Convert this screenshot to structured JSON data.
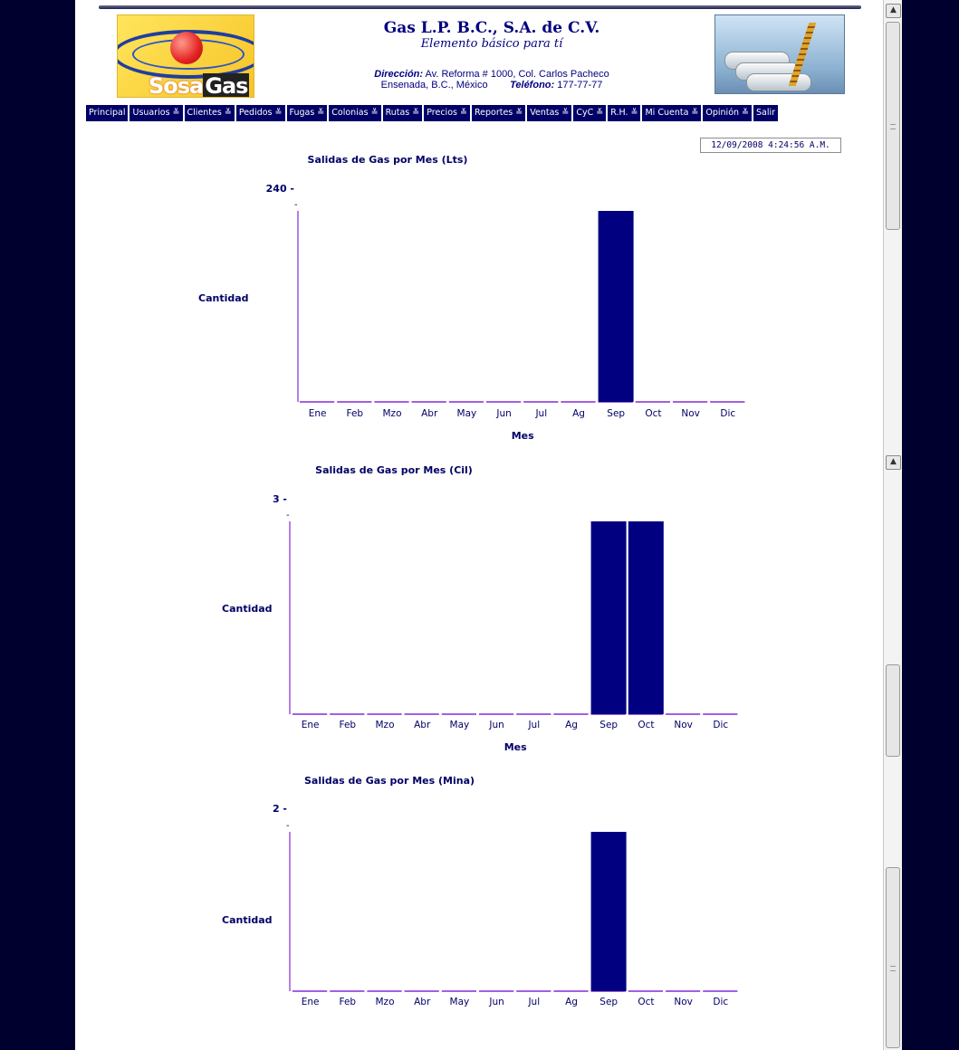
{
  "header": {
    "company": "Gas L.P. B.C., S.A. de C.V.",
    "slogan": "Elemento básico para tí",
    "address_label": "Dirección:",
    "address": "Av. Reforma # 1000, Col. Carlos Pacheco",
    "city": "Ensenada, B.C., México",
    "phone_label": "Teléfono:",
    "phone": "177-77-77",
    "logo_text_1": "Sosa",
    "logo_text_2": "Gas"
  },
  "nav": {
    "items": [
      "Principal",
      "Usuarios ≚",
      "Clientes ≚",
      "Pedidos ≚",
      "Fugas ≚",
      "Colonias ≚",
      "Rutas ≚",
      "Precios ≚",
      "Reportes ≚",
      "Ventas ≚",
      "CyC ≚",
      "R.H. ≚",
      "Mi Cuenta ≚",
      "Opinión ≚",
      "Salir"
    ]
  },
  "datetime": "12/09/2008   4:24:56 A.M.",
  "colors": {
    "bar": "#000080",
    "axis": "#6a00cc",
    "text": "#000066",
    "nav_bg": "#000066"
  },
  "chart_data": [
    {
      "type": "bar",
      "title": "Salidas de Gas por Mes (Lts)",
      "categories": [
        "Ene",
        "Feb",
        "Mzo",
        "Abr",
        "May",
        "Jun",
        "Jul",
        "Ag",
        "Sep",
        "Oct",
        "Nov",
        "Dic"
      ],
      "values": [
        0,
        0,
        0,
        0,
        0,
        0,
        0,
        0,
        240,
        0,
        0,
        0
      ],
      "ylabel": "Cantidad",
      "xlabel": "Mes",
      "ymax_label": "240",
      "ylim": [
        0,
        240
      ],
      "grid": false
    },
    {
      "type": "bar",
      "title": "Salidas de Gas por Mes (Cil)",
      "categories": [
        "Ene",
        "Feb",
        "Mzo",
        "Abr",
        "May",
        "Jun",
        "Jul",
        "Ag",
        "Sep",
        "Oct",
        "Nov",
        "Dic"
      ],
      "values": [
        0,
        0,
        0,
        0,
        0,
        0,
        0,
        0,
        3,
        3,
        0,
        0
      ],
      "ylabel": "Cantidad",
      "xlabel": "Mes",
      "ymax_label": "3",
      "ylim": [
        0,
        3
      ],
      "grid": false
    },
    {
      "type": "bar",
      "title": "Salidas de Gas por Mes (Mina)",
      "categories": [
        "Ene",
        "Feb",
        "Mzo",
        "Abr",
        "May",
        "Jun",
        "Jul",
        "Ag",
        "Sep",
        "Oct",
        "Nov",
        "Dic"
      ],
      "values": [
        0,
        0,
        0,
        0,
        0,
        0,
        0,
        0,
        2,
        0,
        0,
        0
      ],
      "ylabel": "Cantidad",
      "xlabel": "",
      "ymax_label": "2",
      "ylim": [
        0,
        2
      ],
      "grid": false
    }
  ]
}
